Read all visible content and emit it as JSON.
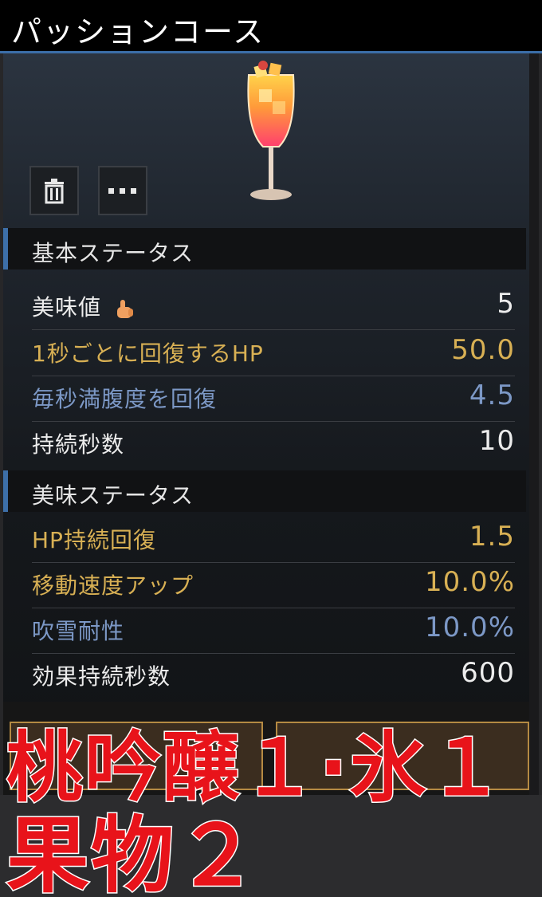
{
  "window": {
    "title": "パッションコース"
  },
  "item": {
    "image": "cocktail-glass-icon",
    "actions": [
      {
        "icon": "trash-icon"
      },
      {
        "icon": "more-icon"
      }
    ]
  },
  "basic_status": {
    "header": "基本ステータス",
    "rows": [
      {
        "label": "美味値",
        "value": "5",
        "icon": "thumbs-up-icon"
      },
      {
        "label": "1秒ごとに回復するHP",
        "value": "50.0"
      },
      {
        "label": "毎秒満腹度を回復",
        "value": "4.5"
      },
      {
        "label": "持続秒数",
        "value": "10"
      }
    ]
  },
  "taste_status": {
    "header": "美味ステータス",
    "rows": [
      {
        "label": "HP持続回復",
        "value": "1.5"
      },
      {
        "label": "移動速度アップ",
        "value": "10.0%"
      },
      {
        "label": "吹雪耐性",
        "value": "10.0%"
      },
      {
        "label": "効果持続秒数",
        "value": "600"
      }
    ]
  },
  "overlay_text": {
    "line1": "桃吟醸１·氷１",
    "line2": "果物２"
  },
  "colors": {
    "white": "#ececec",
    "gold": "#d8b054",
    "blue": "#7c98c6",
    "accent": "#3d6fa8",
    "overlay_red": "#e8131a"
  }
}
